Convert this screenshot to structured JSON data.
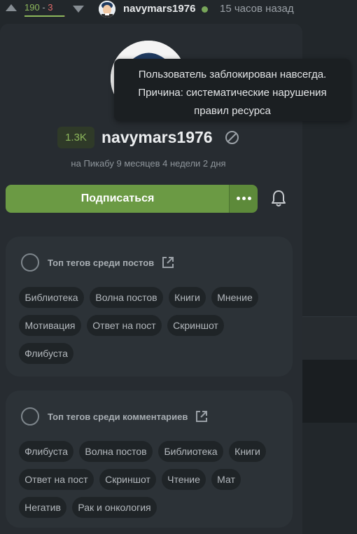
{
  "topbar": {
    "rating_plus": "190",
    "rating_sep": "-",
    "rating_minus": "3",
    "rating_ratio": 0.98,
    "username": "navymars1976",
    "time": "15 часов назад",
    "online_color": "#78a65a"
  },
  "tooltip": {
    "line1": "Пользователь заблокирован навсегда.",
    "line2": "Причина: систематические нарушения",
    "line3": "правил ресурса"
  },
  "profile": {
    "rating": "1.3K",
    "name": "navymars1976",
    "member_since": "на Пикабу 9 месяцев 4 недели 2 дня",
    "blocked_icon": "blocked-icon"
  },
  "actions": {
    "subscribe_label": "Подписаться",
    "more_icon": "more-icon",
    "bell_icon": "bell-icon"
  },
  "colors": {
    "accent_green": "#6b9a44",
    "rating_green": "#8db85c",
    "rating_red": "#e06b6b"
  },
  "post_tags": {
    "title": "Топ тегов среди постов",
    "items": [
      "Библиотека",
      "Волна постов",
      "Книги",
      "Мнение",
      "Мотивация",
      "Ответ на пост",
      "Скриншот",
      "Флибуста"
    ]
  },
  "comment_tags": {
    "title": "Топ тегов среди комментариев",
    "items": [
      "Флибуста",
      "Волна постов",
      "Библиотека",
      "Книги",
      "Ответ на пост",
      "Скриншот",
      "Чтение",
      "Мат",
      "Негатив",
      "Рак и онкология"
    ]
  }
}
